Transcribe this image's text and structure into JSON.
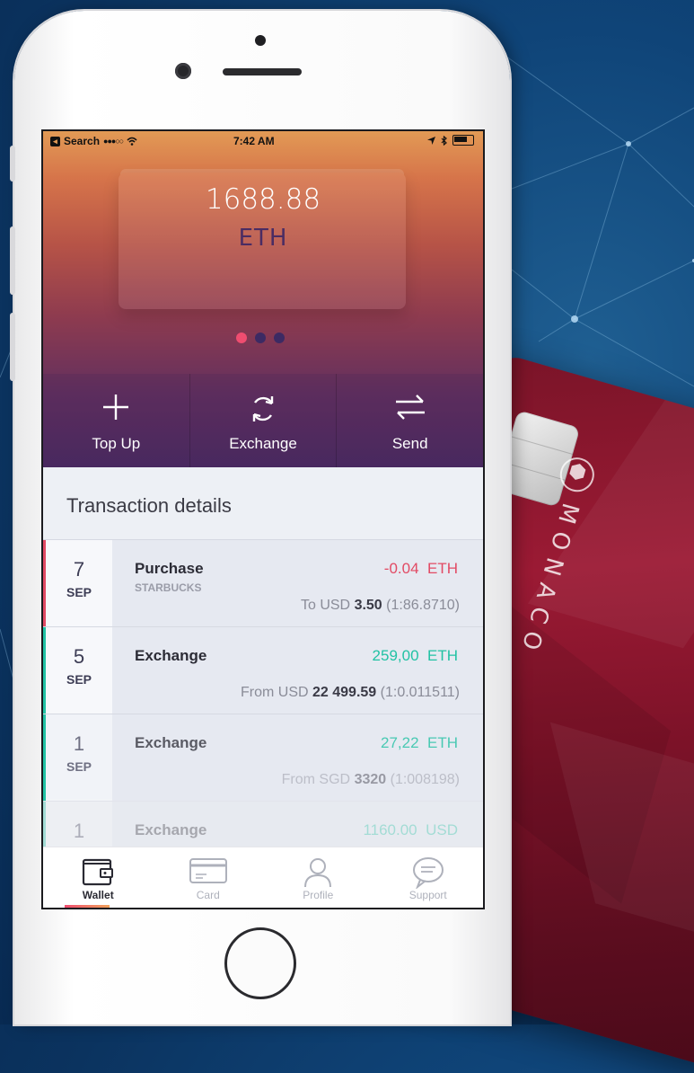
{
  "colors": {
    "accent": "#ef4d70",
    "negative": "#e24a64",
    "positive": "#22c2a4",
    "card": "#9b1a34"
  },
  "promo_card": {
    "brand": "MONACO",
    "logo_icon": "monaco-hexagon-logo"
  },
  "status_bar": {
    "back_label": "Search",
    "signal": "●●●○○",
    "time": "7:42 AM"
  },
  "wallet": {
    "balance": "1688.88",
    "currency": "ETH",
    "pages": 3,
    "active_page": 0
  },
  "actions": [
    {
      "label": "Top Up",
      "icon": "plus-icon"
    },
    {
      "label": "Exchange",
      "icon": "refresh-icon"
    },
    {
      "label": "Send",
      "icon": "swap-arrows-icon"
    }
  ],
  "transactions": {
    "heading": "Transaction details",
    "items": [
      {
        "day": "7",
        "month": "SEP",
        "title": "Purchase",
        "merchant": "STARBUCKS",
        "amount": "-0.04",
        "currency": "ETH",
        "kind": "negative",
        "detail_prefix": "To USD",
        "detail_value": "3.50",
        "detail_rate": "(1:86.8710)"
      },
      {
        "day": "5",
        "month": "SEP",
        "title": "Exchange",
        "merchant": "",
        "amount": "259,00",
        "currency": "ETH",
        "kind": "positive",
        "detail_prefix": "From USD",
        "detail_value": "22 499.59",
        "detail_rate": "(1:0.011511)"
      },
      {
        "day": "1",
        "month": "SEP",
        "title": "Exchange",
        "merchant": "",
        "amount": "27,22",
        "currency": "ETH",
        "kind": "positive",
        "detail_prefix": "From SGD",
        "detail_value": "3320",
        "detail_rate": "(1:008198)"
      },
      {
        "day": "1",
        "month": "",
        "title": "Exchange",
        "merchant": "",
        "amount": "1160.00",
        "currency": "USD",
        "kind": "faded",
        "detail_prefix": "",
        "detail_value": "",
        "detail_rate": ""
      }
    ]
  },
  "tabbar": [
    {
      "label": "Wallet",
      "icon": "wallet-icon",
      "active": true
    },
    {
      "label": "Card",
      "icon": "card-icon",
      "active": false
    },
    {
      "label": "Profile",
      "icon": "profile-icon",
      "active": false
    },
    {
      "label": "Support",
      "icon": "chat-bubble-icon",
      "active": false
    }
  ]
}
